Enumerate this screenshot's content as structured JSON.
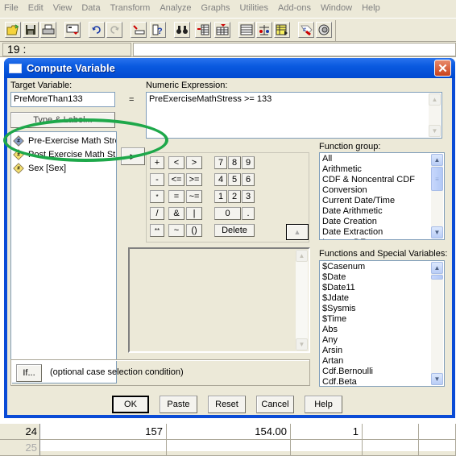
{
  "menubar": {
    "items": [
      "File",
      "Edit",
      "View",
      "Data",
      "Transform",
      "Analyze",
      "Graphs",
      "Utilities",
      "Add-ons",
      "Window",
      "Help"
    ]
  },
  "toolbar": {
    "buttons": [
      {
        "icon": "open-folder-icon"
      },
      {
        "icon": "save-icon"
      },
      {
        "icon": "print-icon"
      },
      {
        "icon": "dialog-recall-icon"
      },
      {
        "icon": "undo-icon"
      },
      {
        "icon": "redo-icon"
      },
      {
        "icon": "goto-case-icon"
      },
      {
        "icon": "variables-info-icon"
      },
      {
        "icon": "find-icon"
      },
      {
        "icon": "insert-cases-icon"
      },
      {
        "icon": "insert-variable-icon"
      },
      {
        "icon": "split-file-icon"
      },
      {
        "icon": "weight-cases-icon"
      },
      {
        "icon": "select-cases-icon"
      },
      {
        "icon": "value-labels-icon"
      },
      {
        "icon": "use-sets-icon"
      }
    ]
  },
  "editor": {
    "cell_ref": "19 :",
    "cell_value": "",
    "rows": [
      {
        "row": "24",
        "cells": [
          "157",
          "154.00",
          "1",
          ""
        ]
      },
      {
        "row": "25",
        "cells": [
          "",
          "",
          "",
          ""
        ]
      }
    ]
  },
  "dialog": {
    "title": "Compute Variable",
    "close_label": "✕",
    "target_variable_label": "Target Variable:",
    "target_variable_value": "PreMoreThan133",
    "equals_sign": "=",
    "numeric_expression_label": "Numeric Expression:",
    "numeric_expression_value": "PreExerciseMathStress >= 133",
    "type_label_button": "Type & Label...",
    "move_button": "▶",
    "variables": [
      {
        "label": "Pre-Exercise Math Stre",
        "selected": true
      },
      {
        "label": "Post Exercise Math Str",
        "selected": false
      },
      {
        "label": "Sex [Sex]",
        "selected": false
      }
    ],
    "keypad": [
      "+",
      "<",
      ">",
      "7",
      "8",
      "9",
      "-",
      "<=",
      ">=",
      "4",
      "5",
      "6",
      "*",
      "=",
      "~=",
      "1",
      "2",
      "3",
      "/",
      "&",
      "|",
      "0",
      ".",
      "**",
      "~",
      "()",
      "Delete"
    ],
    "function_group_label": "Function group:",
    "function_groups": [
      "All",
      "Arithmetic",
      "CDF & Noncentral CDF",
      "Conversion",
      "Current Date/Time",
      "Date Arithmetic",
      "Date Creation",
      "Date Extraction",
      "Inverse DF"
    ],
    "functions_label": "Functions and Special Variables:",
    "functions": [
      "$Casenum",
      "$Date",
      "$Date11",
      "$Jdate",
      "$Sysmis",
      "$Time",
      "Abs",
      "Any",
      "Arsin",
      "Artan",
      "Cdf.Bernoulli",
      "Cdf.Beta"
    ],
    "if_button": "If...",
    "if_condition_text": "(optional case selection condition)",
    "buttons": {
      "ok": "OK",
      "paste": "Paste",
      "reset": "Reset",
      "cancel": "Cancel",
      "help": "Help"
    }
  }
}
